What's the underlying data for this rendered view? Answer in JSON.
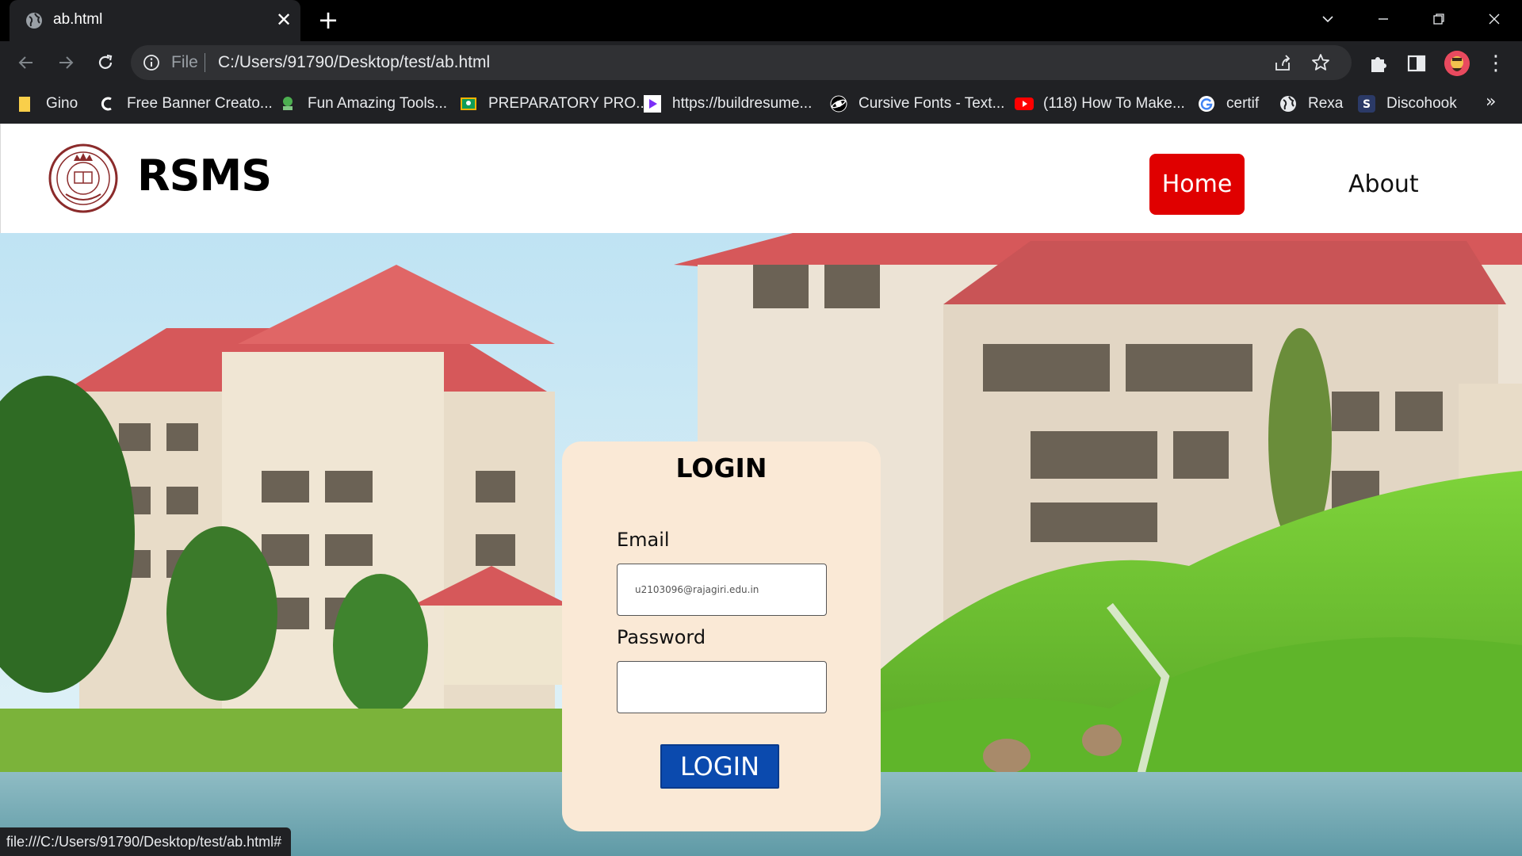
{
  "browser": {
    "tab_title": "ab.html",
    "address_scheme": "File",
    "address_url": "C:/Users/91790/Desktop/test/ab.html",
    "bookmarks": [
      {
        "label": "Gino",
        "icon": "folder-icon"
      },
      {
        "label": "Free Banner Creato...",
        "icon": "c-logo-icon"
      },
      {
        "label": "Fun Amazing Tools...",
        "icon": "green-tool-icon"
      },
      {
        "label": "PREPARATORY PRO...",
        "icon": "classroom-icon"
      },
      {
        "label": "https://buildresume...",
        "icon": "play-icon"
      },
      {
        "label": "Cursive Fonts - Text...",
        "icon": "planet-icon"
      },
      {
        "label": "(118) How To Make...",
        "icon": "youtube-icon"
      },
      {
        "label": "certif",
        "icon": "google-icon"
      },
      {
        "label": "Rexa",
        "icon": "globe-icon"
      },
      {
        "label": "Discohook",
        "icon": "discohook-icon"
      }
    ],
    "bookmarks_more": "»",
    "status_url": "file:///C:/Users/91790/Desktop/test/ab.html#"
  },
  "site": {
    "brand": "RSMS",
    "nav": {
      "home": "Home",
      "about": "About"
    },
    "colors": {
      "home_button": "#e00000",
      "card_bg": "#fae9d6",
      "login_button": "#0b4aae"
    }
  },
  "login": {
    "title": "LOGIN",
    "email_label": "Email",
    "email_value": "u2103096@rajagiri.edu.in",
    "password_label": "Password",
    "password_value": "",
    "submit_label": "LOGIN"
  }
}
